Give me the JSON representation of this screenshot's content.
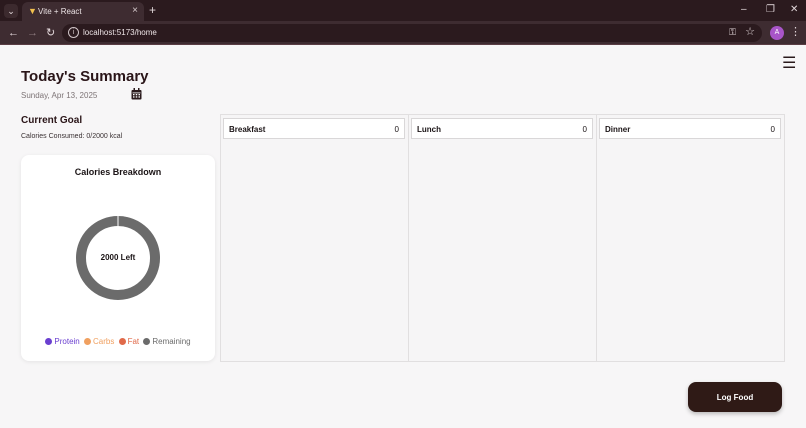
{
  "browser": {
    "tab_title": "Vite + React",
    "url": "localhost:5173/home",
    "profile_initial": "A"
  },
  "header": {
    "title": "Today's Summary",
    "date": "Sunday, Apr 13, 2025"
  },
  "goal": {
    "title": "Current Goal",
    "calories_text": "Calories Consumed: 0/2000 kcal"
  },
  "breakdown": {
    "title": "Calories Breakdown",
    "center_label": "2000 Left",
    "remaining_fraction": 1.0,
    "legend": [
      {
        "label": "Protein",
        "color": "#6a3fd0"
      },
      {
        "label": "Carbs",
        "color": "#f0a060"
      },
      {
        "label": "Fat",
        "color": "#e06a4a"
      },
      {
        "label": "Remaining",
        "color": "#6b6b6b"
      }
    ]
  },
  "meals": [
    {
      "name": "Breakfast",
      "count": "0"
    },
    {
      "name": "Lunch",
      "count": "0"
    },
    {
      "name": "Dinner",
      "count": "0"
    }
  ],
  "actions": {
    "log_food": "Log Food"
  },
  "colors": {
    "accent_dark": "#2f1a16",
    "donut_remaining": "#6b6b6b"
  }
}
